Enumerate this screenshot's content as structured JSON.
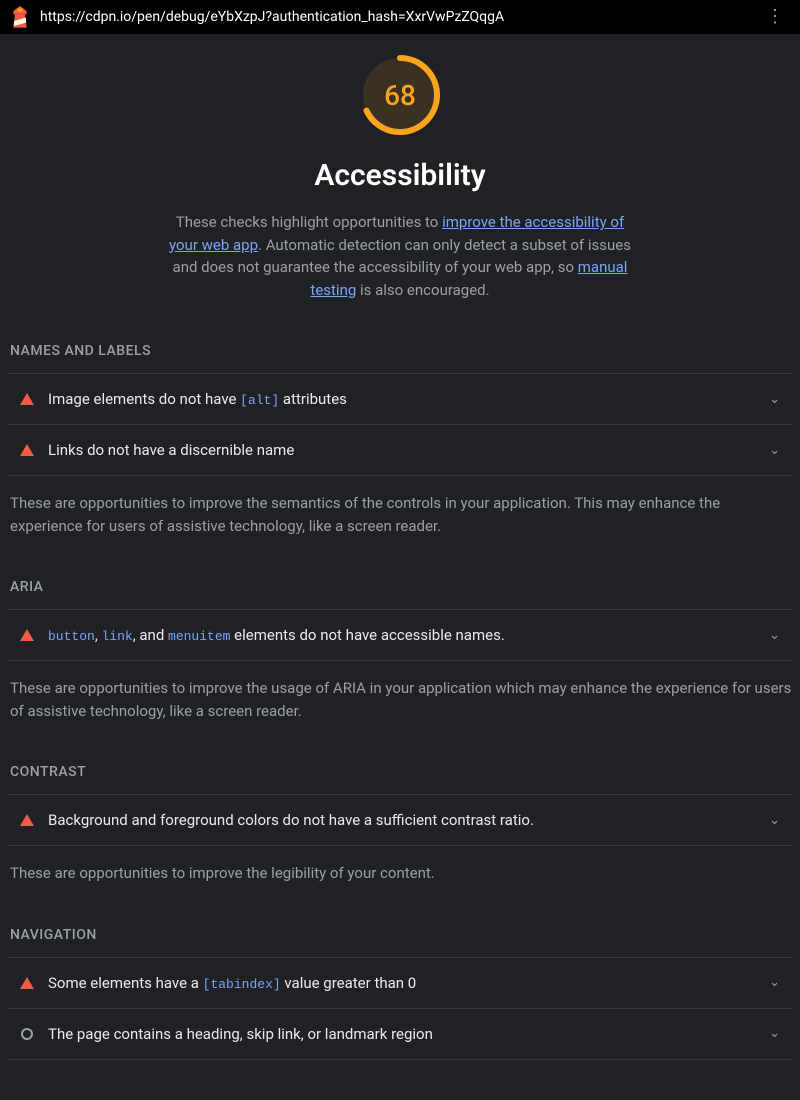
{
  "topbar": {
    "url": "https://cdpn.io/pen/debug/eYbXzpJ?authentication_hash=XxrVwPzZQqgA"
  },
  "gauge": {
    "score": "68"
  },
  "title": "Accessibility",
  "desc": {
    "before": "These checks highlight opportunities to ",
    "link1": "improve the accessibility of your web app",
    "mid": ". Automatic detection can only detect a subset of issues and does not guarantee the accessibility of your web app, so ",
    "link2": "manual testing",
    "after": " is also encouraged."
  },
  "sections": {
    "names_labels": {
      "header": "NAMES AND LABELS",
      "description": "These are opportunities to improve the semantics of the controls in your application. This may enhance the experience for users of assistive technology, like a screen reader.",
      "audits": [
        {
          "before": "Image elements do not have ",
          "code": "[alt]",
          "after": " attributes"
        },
        {
          "before": "Links do not have a discernible name",
          "code": "",
          "after": ""
        }
      ]
    },
    "aria": {
      "header": "ARIA",
      "description": "These are opportunities to improve the usage of ARIA in your application which may enhance the experience for users of assistive technology, like a screen reader.",
      "audit": {
        "code1": "button",
        "sep1": ", ",
        "code2": "link",
        "sep2": ", and ",
        "code3": "menuitem",
        "after": " elements do not have accessible names."
      }
    },
    "contrast": {
      "header": "CONTRAST",
      "description": "These are opportunities to improve the legibility of your content.",
      "audit": "Background and foreground colors do not have a sufficient contrast ratio."
    },
    "navigation": {
      "header": "NAVIGATION",
      "audits": [
        {
          "before": "Some elements have a ",
          "code": "[tabindex]",
          "after": " value greater than 0",
          "status": "warn"
        },
        {
          "before": "The page contains a heading, skip link, or landmark region",
          "code": "",
          "after": "",
          "status": "ok"
        }
      ]
    }
  }
}
